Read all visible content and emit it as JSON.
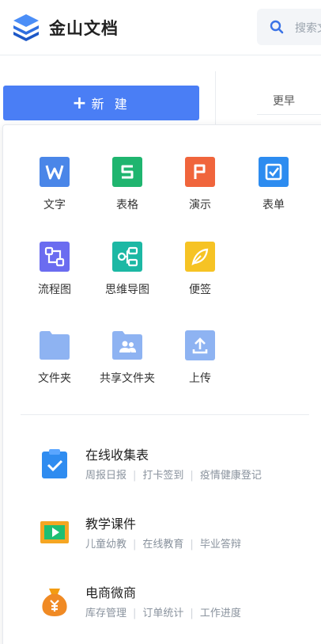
{
  "app": {
    "title": "金山文档"
  },
  "search": {
    "placeholder": "搜索文"
  },
  "toolbar": {
    "new_label": "新 建",
    "plus": "+",
    "sort_label": "更早"
  },
  "new_menu": {
    "items": [
      {
        "label": "文字",
        "icon": "word-doc-icon",
        "color": "#4a86e8"
      },
      {
        "label": "表格",
        "icon": "spreadsheet-icon",
        "color": "#1fb56f"
      },
      {
        "label": "演示",
        "icon": "presentation-icon",
        "color": "#f0653c"
      },
      {
        "label": "表单",
        "icon": "form-icon",
        "color": "#2d8cf0"
      },
      {
        "label": "流程图",
        "icon": "flowchart-icon",
        "color": "#6b6cf0"
      },
      {
        "label": "思维导图",
        "icon": "mindmap-icon",
        "color": "#1cb8a4"
      },
      {
        "label": "便签",
        "icon": "note-icon",
        "color": "#f6c324"
      },
      {
        "label": "文件夹",
        "icon": "folder-icon",
        "color": "#8eb3f2"
      },
      {
        "label": "共享文件夹",
        "icon": "shared-folder-icon",
        "color": "#8eb3f2"
      },
      {
        "label": "上传",
        "icon": "upload-icon",
        "color": "#8eb3f2"
      }
    ],
    "templates": [
      {
        "title": "在线收集表",
        "icon": "clipboard-check-icon",
        "tags": [
          "周报日报",
          "打卡签到",
          "疫情健康登记"
        ]
      },
      {
        "title": "教学课件",
        "icon": "courseware-play-icon",
        "tags": [
          "儿童幼教",
          "在线教育",
          "毕业答辩"
        ]
      },
      {
        "title": "电商微商",
        "icon": "money-bag-icon",
        "tags": [
          "库存管理",
          "订单统计",
          "工作进度"
        ]
      }
    ]
  }
}
